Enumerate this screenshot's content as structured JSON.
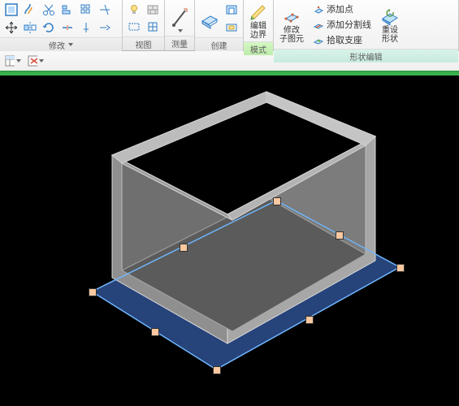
{
  "ribbon": {
    "panels": {
      "modify": {
        "label": "修改"
      },
      "view": {
        "label": "视图"
      },
      "measure": {
        "label": "测量"
      },
      "create": {
        "label": "创建"
      },
      "mode": {
        "label": "模式"
      },
      "shape": {
        "label": "形状编辑"
      }
    },
    "buttons": {
      "edit_boundary": "编辑\n边界",
      "modify_sub": "修改\n子图元",
      "reset_shape": "重设\n形状",
      "add_point": "添加点",
      "add_split": "添加分割线",
      "pick_support": "拾取支座"
    }
  }
}
